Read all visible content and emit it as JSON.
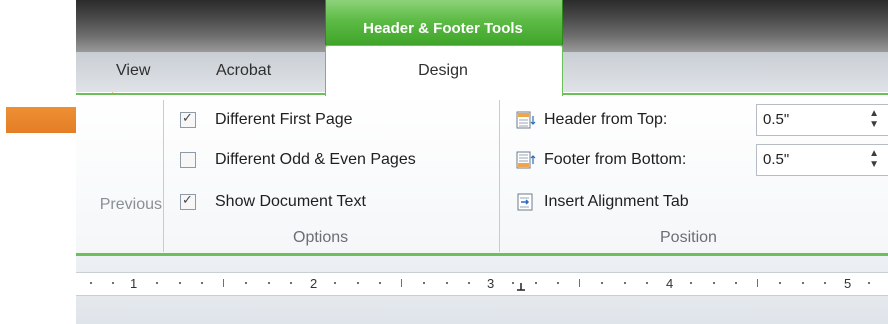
{
  "header": {
    "contextual_tab_title": "Header & Footer Tools",
    "tabs": [
      {
        "label": "View"
      },
      {
        "label": "Acrobat"
      },
      {
        "label": "Design"
      }
    ]
  },
  "navigation": {
    "previous_label": "Previous"
  },
  "options": {
    "group_label": "Options",
    "items": [
      {
        "label": "Different First Page",
        "checked": true
      },
      {
        "label": "Different Odd & Even Pages",
        "checked": false
      },
      {
        "label": "Show Document Text",
        "checked": true
      }
    ]
  },
  "position": {
    "group_label": "Position",
    "header_from_top": {
      "label": "Header from Top:",
      "value": "0.5\""
    },
    "footer_from_bottom": {
      "label": "Footer from Bottom:",
      "value": "0.5\""
    },
    "insert_alignment_tab": {
      "label": "Insert Alignment Tab"
    }
  },
  "ruler": {
    "numbers": [
      "1",
      "2",
      "3",
      "4",
      "5"
    ]
  },
  "colors": {
    "accent_green": "#6cc05a",
    "callout_orange": "#e8842c"
  },
  "icons": {
    "header_from_top": "header-position-icon",
    "footer_from_bottom": "footer-position-icon",
    "insert_alignment_tab": "insert-alignment-tab-icon",
    "callout": "orange-arrow-icon"
  }
}
